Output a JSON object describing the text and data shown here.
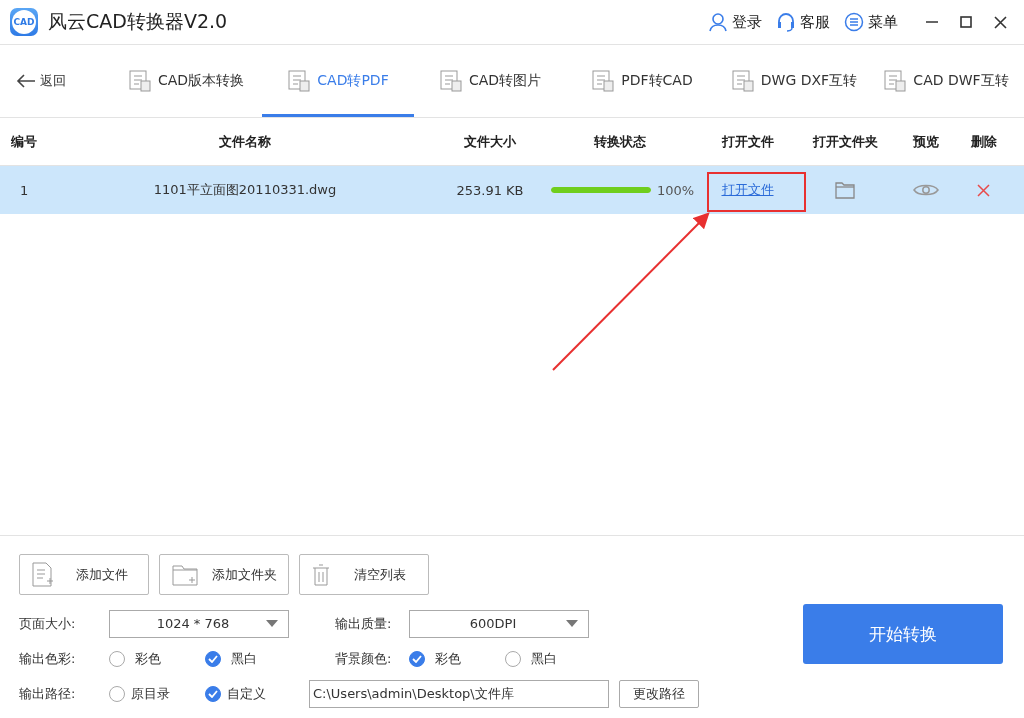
{
  "window": {
    "logo_text": "CAD",
    "title": "风云CAD转换器V2.0",
    "actions": [
      {
        "kind": "user",
        "label": "登录"
      },
      {
        "kind": "headset",
        "label": "客服"
      },
      {
        "kind": "menu",
        "label": "菜单"
      }
    ]
  },
  "nav": {
    "back": "返回",
    "tabs": [
      {
        "label": "CAD版本转换",
        "selected": false
      },
      {
        "label": "CAD转PDF",
        "selected": true
      },
      {
        "label": "CAD转图片",
        "selected": false
      },
      {
        "label": "PDF转CAD",
        "selected": false
      },
      {
        "label": "DWG DXF互转",
        "selected": false
      },
      {
        "label": "CAD DWF互转",
        "selected": false
      }
    ]
  },
  "table": {
    "columns": [
      "编号",
      "文件名称",
      "文件大小",
      "转换状态",
      "打开文件",
      "打开文件夹",
      "预览",
      "删除"
    ],
    "rows": [
      {
        "number": "1",
        "name": "1101平立面图20110331.dwg",
        "size": "253.91 KB",
        "level": 1,
        "percent": "100%",
        "open_link": "打开文件",
        "selected": true
      }
    ]
  },
  "annotation": {
    "highlight": true
  },
  "buttons": [
    {
      "kind": "file",
      "label": "添加文件"
    },
    {
      "kind": "folder",
      "label": "添加文件夹"
    },
    {
      "kind": "trash",
      "label": "清空列表"
    }
  ],
  "page_size": {
    "label": "页面大小:",
    "value": "1024 * 768"
  },
  "quality": {
    "label": "输出质量:",
    "value": "600DPI"
  },
  "output_color": {
    "label": "输出色彩:",
    "options": [
      {
        "label": "彩色",
        "selected": false
      },
      {
        "label": "黑白",
        "selected": true
      }
    ]
  },
  "background_color": {
    "label": "背景颜色:",
    "options": [
      {
        "label": "彩色",
        "selected": true
      },
      {
        "label": "黑白",
        "selected": false
      }
    ]
  },
  "output_path": {
    "label": "输出路径:",
    "options": [
      {
        "label": "原目录",
        "selected": false
      },
      {
        "label": "自定义",
        "selected": true
      }
    ],
    "value": "C:\\Users\\admin\\Desktop\\文件库",
    "change_button": "更改路径"
  },
  "start_button": "开始转换"
}
